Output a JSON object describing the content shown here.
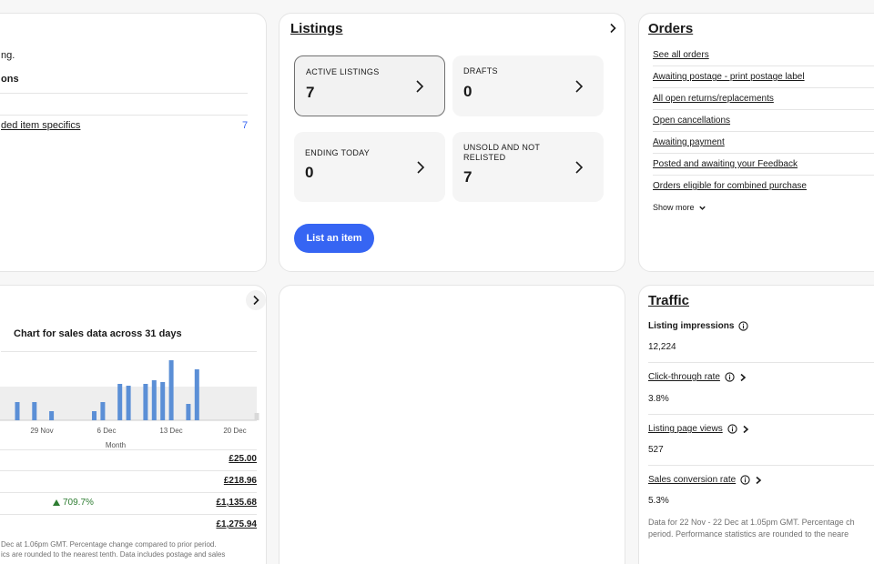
{
  "cardA": {
    "line1": "ng.",
    "line2": "ons",
    "row_link": "ded item specifics",
    "row_count": "7"
  },
  "listings": {
    "title": "Listings",
    "tiles": [
      {
        "label": "ACTIVE LISTINGS",
        "value": "7"
      },
      {
        "label": "DRAFTS",
        "value": "0"
      },
      {
        "label": "ENDING TODAY",
        "value": "0"
      },
      {
        "label": "UNSOLD AND NOT RELISTED",
        "value": "7"
      }
    ],
    "button": "List an item"
  },
  "orders": {
    "title": "Orders",
    "links": [
      "See all orders",
      "Awaiting postage - print postage label",
      "All open returns/replacements",
      "Open cancellations",
      "Awaiting payment",
      "Posted and awaiting your Feedback",
      "Orders eligible for combined purchase"
    ],
    "show_more": "Show more"
  },
  "sales": {
    "chart_title": "Chart for sales data across 31 days",
    "rows": [
      {
        "change": "",
        "value": "£25.00"
      },
      {
        "change": "",
        "value": "£218.96"
      },
      {
        "change": "709.7%",
        "value": "£1,135.68"
      },
      {
        "change": "",
        "value": "£1,275.94"
      }
    ],
    "footnote1": "Dec at 1.06pm GMT. Percentage change compared to prior period.",
    "footnote2": "ics are rounded to the nearest tenth. Data includes postage and sales"
  },
  "chart_data": {
    "type": "bar",
    "title": "Chart for sales data across 31 days",
    "xlabel": "Month",
    "ylabel": "",
    "x_tick_labels": [
      "29 Nov",
      "6 Dec",
      "13 Dec",
      "20 Dec"
    ],
    "values": [
      1,
      0,
      1,
      0,
      0.5,
      0,
      0,
      0,
      0,
      0.5,
      1,
      0,
      2,
      1.9,
      0,
      2,
      2.2,
      2.1,
      3.3,
      0,
      0.9,
      2.8,
      0,
      0,
      0,
      0,
      0,
      0,
      0.4
    ],
    "colors": {
      "bar": "#5b8fd6",
      "future": "#d9d9d9",
      "band": "#eeeeee"
    },
    "grid": false
  },
  "traffic": {
    "title": "Traffic",
    "metrics": [
      {
        "label": "Listing impressions",
        "value": "12,224"
      },
      {
        "label": "Click-through rate",
        "value": "3.8%"
      },
      {
        "label": "Listing page views",
        "value": "527"
      },
      {
        "label": "Sales conversion rate",
        "value": "5.3%"
      }
    ],
    "footnote1": "Data for 22 Nov - 22 Dec at 1.05pm GMT. Percentage ch",
    "footnote2": "period. Performance statistics are rounded to the neare"
  },
  "colors": {
    "accent": "#3665f3",
    "positive": "#2e7d32",
    "border": "#e5e5e5"
  },
  "icons": {
    "chevron": "chevron-right-icon",
    "info": "info-icon"
  }
}
